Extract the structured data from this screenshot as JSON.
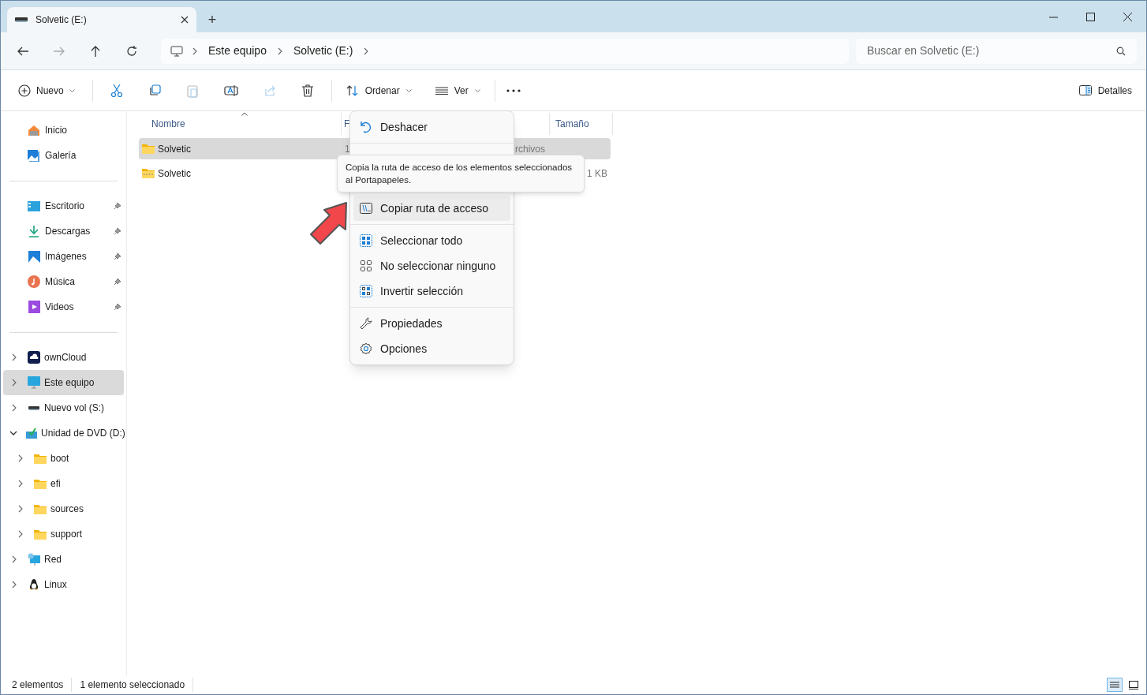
{
  "window": {
    "tab_title": "Solvetic (E:)",
    "new_tab": "+"
  },
  "address_bar": {
    "breadcrumb": [
      "Este equipo",
      "Solvetic (E:)"
    ],
    "search_placeholder": "Buscar en Solvetic (E:)"
  },
  "toolbar": {
    "new_label": "Nuevo",
    "sort_label": "Ordenar",
    "view_label": "Ver",
    "details_label": "Detalles"
  },
  "sidebar": {
    "quick": [
      {
        "label": "Inicio",
        "kind": "home"
      },
      {
        "label": "Galería",
        "kind": "gallery"
      }
    ],
    "pinned": [
      {
        "label": "Escritorio",
        "kind": "desktop"
      },
      {
        "label": "Descargas",
        "kind": "download"
      },
      {
        "label": "Imágenes",
        "kind": "pictures"
      },
      {
        "label": "Música",
        "kind": "music"
      },
      {
        "label": "Videos",
        "kind": "video"
      }
    ],
    "tree": [
      {
        "label": "ownCloud",
        "kind": "cloud",
        "selected": false,
        "expanded": false
      },
      {
        "label": "Este equipo",
        "kind": "pc",
        "selected": true,
        "expanded": false
      },
      {
        "label": "Nuevo vol (S:)",
        "kind": "drive",
        "selected": false,
        "expanded": false
      },
      {
        "label": "Unidad de DVD (D:)",
        "kind": "dvd",
        "selected": false,
        "expanded": true,
        "children": [
          {
            "label": "boot",
            "kind": "folder",
            "selected": false,
            "expanded": false
          },
          {
            "label": "efi",
            "kind": "folder",
            "selected": false,
            "expanded": false
          },
          {
            "label": "sources",
            "kind": "folder",
            "selected": false,
            "expanded": false
          },
          {
            "label": "support",
            "kind": "folder",
            "selected": false,
            "expanded": false
          }
        ]
      },
      {
        "label": "Red",
        "kind": "network",
        "selected": false,
        "expanded": false
      },
      {
        "label": "Linux",
        "kind": "linux",
        "selected": false,
        "expanded": false
      }
    ]
  },
  "file_list": {
    "columns": {
      "name": "Nombre",
      "date": "F",
      "size": "Tamaño"
    },
    "rows": [
      {
        "name": "Solvetic",
        "kind": "folder",
        "selected": true,
        "date": "1",
        "type": "rchivos"
      },
      {
        "name": "Solvetic",
        "kind": "zip",
        "selected": false,
        "size": "1 KB"
      }
    ]
  },
  "context_menu": {
    "items": [
      {
        "kind": "undo",
        "label": "Deshacer",
        "hovered": false
      },
      {
        "kind": "separator"
      },
      {
        "kind": "path",
        "label": "Copiar ruta de acceso",
        "hovered": true
      },
      {
        "kind": "separator"
      },
      {
        "kind": "select-all",
        "label": "Seleccionar todo",
        "hovered": false
      },
      {
        "kind": "select-none",
        "label": "No seleccionar ninguno",
        "hovered": false
      },
      {
        "kind": "invert",
        "label": "Invertir selección",
        "hovered": false
      },
      {
        "kind": "separator"
      },
      {
        "kind": "wrench",
        "label": "Propiedades",
        "hovered": false
      },
      {
        "kind": "gear",
        "label": "Opciones",
        "hovered": false
      }
    ]
  },
  "tooltip": "Copia la ruta de acceso de los elementos seleccionados al Portapapeles.",
  "status_bar": {
    "item_count": "2 elementos",
    "selection": "1 elemento seleccionado"
  },
  "view_buttons": [
    {
      "kind": "details",
      "selected": true
    },
    {
      "kind": "tiles",
      "selected": false
    }
  ]
}
